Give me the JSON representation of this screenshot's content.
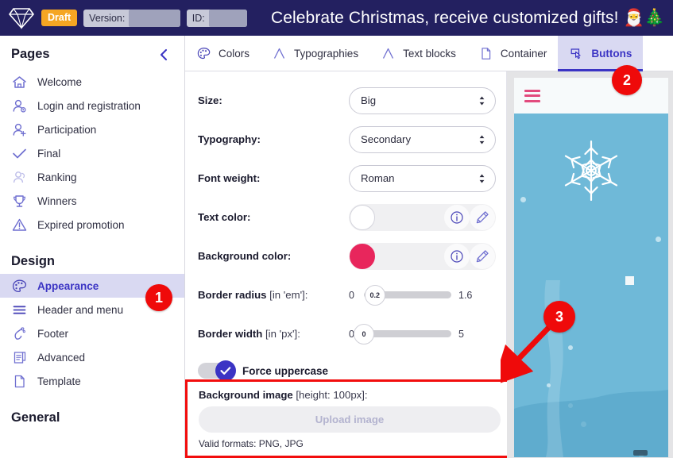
{
  "topbar": {
    "logo_icon": "diamond-icon",
    "draft_badge": "Draft",
    "version_label": "Version:",
    "version_value": "",
    "id_label": "ID:",
    "id_value": "",
    "promo_title": "Celebrate Christmas, receive customized gifts! 🎅🎄",
    "bg_color": "#232060",
    "draft_color": "#f5a623"
  },
  "sidebar": {
    "pages_title": "Pages",
    "collapse_icon": "chevron-left-icon",
    "pages": [
      {
        "label": "Welcome",
        "icon": "home-icon",
        "active": false,
        "muted": false
      },
      {
        "label": "Login and registration",
        "icon": "user-settings-icon",
        "active": false,
        "muted": false
      },
      {
        "label": "Participation",
        "icon": "user-add-icon",
        "active": false,
        "muted": false
      },
      {
        "label": "Final",
        "icon": "check-icon",
        "active": false,
        "muted": false
      },
      {
        "label": "Ranking",
        "icon": "user-group-icon",
        "active": false,
        "muted": true
      },
      {
        "label": "Winners",
        "icon": "trophy-icon",
        "active": false,
        "muted": false
      },
      {
        "label": "Expired promotion",
        "icon": "warning-triangle-icon",
        "active": false,
        "muted": false
      }
    ],
    "design_title": "Design",
    "design": [
      {
        "label": "Appearance",
        "icon": "palette-icon",
        "active": true,
        "muted": false
      },
      {
        "label": "Header and menu",
        "icon": "menu-lines-icon",
        "active": false,
        "muted": false
      },
      {
        "label": "Footer",
        "icon": "footer-icon",
        "active": false,
        "muted": false
      },
      {
        "label": "Advanced",
        "icon": "scroll-icon",
        "active": false,
        "muted": false
      },
      {
        "label": "Template",
        "icon": "page-icon",
        "active": false,
        "muted": false
      }
    ],
    "general_title": "General"
  },
  "tabs": [
    {
      "label": "Colors",
      "icon": "palette-icon",
      "active": false
    },
    {
      "label": "Typographies",
      "icon": "typography-icon",
      "active": false
    },
    {
      "label": "Text blocks",
      "icon": "typography-icon",
      "active": false
    },
    {
      "label": "Container",
      "icon": "page-icon",
      "active": false
    },
    {
      "label": "Buttons",
      "icon": "button-click-icon",
      "active": true
    }
  ],
  "form": {
    "size": {
      "label": "Size:",
      "value": "Big"
    },
    "typography": {
      "label": "Typography:",
      "value": "Secondary"
    },
    "font_weight": {
      "label": "Font weight:",
      "value": "Roman"
    },
    "text_color": {
      "label": "Text color:",
      "swatch": "#ffffff",
      "info_icon": "info-icon",
      "edit_icon": "pencil-icon"
    },
    "background_color": {
      "label": "Background color:",
      "swatch": "#e8265c",
      "info_icon": "info-icon",
      "edit_icon": "pencil-icon"
    },
    "border_radius": {
      "label": "Border radius",
      "unit": "[in 'em']:",
      "min": "0",
      "max": "1.6",
      "value": "0.2",
      "percent": 12.5
    },
    "border_width": {
      "label": "Border width",
      "unit": "[in 'px']:",
      "min": "0",
      "max": "5",
      "value": "0",
      "percent": 0
    },
    "force_uppercase": {
      "label": "Force uppercase",
      "checked": true,
      "check_icon": "check-icon"
    },
    "background_image": {
      "label": "Background image",
      "hint": "[height: 100px]:",
      "upload_label": "Upload image",
      "formats_note": "Valid formats: PNG, JPG",
      "highlight_color": "#f20d0d"
    }
  },
  "preview": {
    "menu_icon": "hamburger-menu-icon",
    "snowflake_icon": "snowflake-icon",
    "bg_color": "#6fb9d8",
    "accent_color": "#e24a7d"
  },
  "markers": [
    {
      "id": "1",
      "number": "1"
    },
    {
      "id": "2",
      "number": "2"
    },
    {
      "id": "3",
      "number": "3"
    }
  ]
}
